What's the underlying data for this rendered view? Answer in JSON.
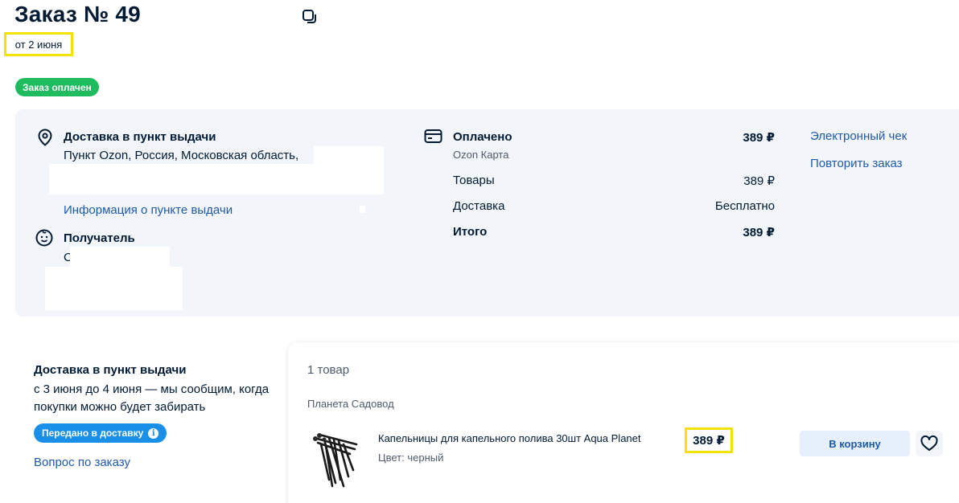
{
  "header": {
    "title": "Заказ № 49",
    "date": "от 2 июня",
    "status_badge": "Заказ оплачен"
  },
  "delivery": {
    "title": "Доставка в пункт выдачи",
    "address": "Пункт Ozon, Россия, Московская область,",
    "info_link": "Информация о пункте выдачи"
  },
  "recipient": {
    "title": "Получатель",
    "name_initial": "С"
  },
  "payment": {
    "status": "Оплачено",
    "method": "Ozon Карта",
    "total_paid": "389 ₽",
    "items_label": "Товары",
    "items_value": "389 ₽",
    "delivery_label": "Доставка",
    "delivery_value": "Бесплатно",
    "total_label": "Итого",
    "total_value": "389 ₽"
  },
  "actions": {
    "receipt_link": "Электронный чек",
    "repeat_link": "Повторить заказ"
  },
  "shipment": {
    "title": "Доставка в пункт выдачи",
    "text": "с 3 июня до 4 июня — мы сообщим, когда покупки можно будет забирать",
    "status_badge": "Передано в доставку",
    "question_link": "Вопрос по заказу"
  },
  "items": {
    "count": "1 товар",
    "seller": "Планета Садовод",
    "product": {
      "name": "Капельницы для капельного полива 30шт Aqua Planet",
      "color": "Цвет: черный",
      "price": "389 ₽",
      "cart_button": "В корзину"
    }
  },
  "colors": {
    "accent_link": "#1f5aa9",
    "paid_green": "#1fbc5f",
    "shipping_blue": "#1a8fe8",
    "highlight_yellow": "#f5e200",
    "panel_bg": "#f2f5f9"
  }
}
